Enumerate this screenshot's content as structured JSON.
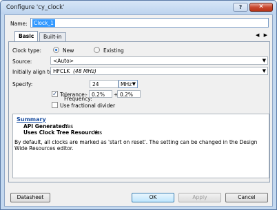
{
  "window": {
    "title": "Configure 'cy_clock'",
    "help_label": "?",
    "close_label": "✕"
  },
  "name": {
    "label": "Name:",
    "value": "Clock_1"
  },
  "tabs": [
    {
      "label": "Basic"
    },
    {
      "label": "Built-in"
    }
  ],
  "tab_arrows": "◀ ▶",
  "clock_type": {
    "label": "Clock type:",
    "options": [
      "New",
      "Existing"
    ],
    "selected": "New"
  },
  "source": {
    "label": "Source:",
    "value": "<Auto>"
  },
  "align": {
    "label": "Initially align to:",
    "value": "HFCLK",
    "hint": "(48 MHz)"
  },
  "specify": {
    "label": "Specify:",
    "frequency_label": "Frequency:",
    "frequency_value": "24",
    "unit": "MHz",
    "tolerance_label": "Tolerance:",
    "tolerance_checked": true,
    "tol_minus_sign": "-",
    "tol_minus": "0.2%",
    "tol_plus_sign": "+",
    "tol_plus": "0.2%",
    "fractional_label": "Use fractional divider"
  },
  "summary": {
    "title": "Summary",
    "api_label": "API Generated:",
    "api_value": "Yes",
    "ctr_label": "Uses Clock Tree Resource:",
    "ctr_value": "Yes",
    "note": "By default, all clocks are marked as 'start on reset'. The setting can be changed in the Design Wide Resources editor."
  },
  "buttons": {
    "datasheet": "Datasheet",
    "ok": "OK",
    "apply": "Apply",
    "cancel": "Cancel"
  }
}
